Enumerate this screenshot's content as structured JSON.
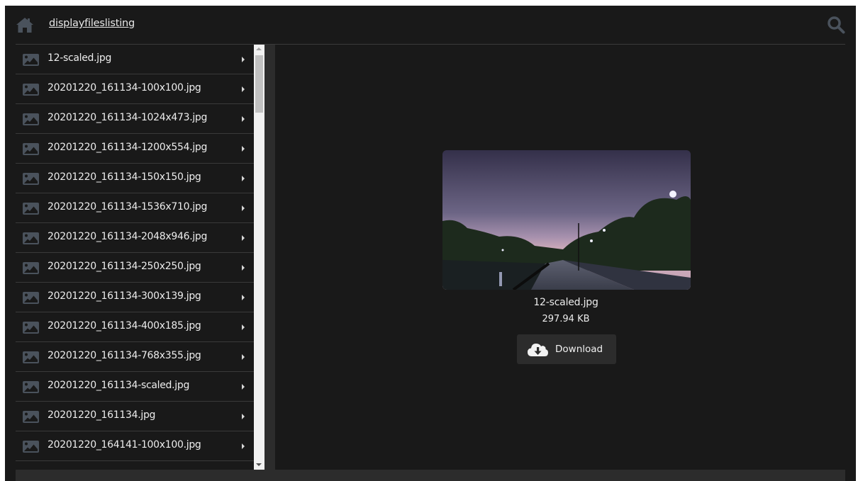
{
  "header": {
    "home_icon": "home-icon",
    "title": "displayfileslisting",
    "search_icon": "search-icon"
  },
  "files": [
    {
      "name": "12-scaled.jpg",
      "icon": "image-icon"
    },
    {
      "name": "20201220_161134-100x100.jpg",
      "icon": "image-icon"
    },
    {
      "name": "20201220_161134-1024x473.jpg",
      "icon": "image-icon"
    },
    {
      "name": "20201220_161134-1200x554.jpg",
      "icon": "image-icon"
    },
    {
      "name": "20201220_161134-150x150.jpg",
      "icon": "image-icon"
    },
    {
      "name": "20201220_161134-1536x710.jpg",
      "icon": "image-icon"
    },
    {
      "name": "20201220_161134-2048x946.jpg",
      "icon": "image-icon"
    },
    {
      "name": "20201220_161134-250x250.jpg",
      "icon": "image-icon"
    },
    {
      "name": "20201220_161134-300x139.jpg",
      "icon": "image-icon"
    },
    {
      "name": "20201220_161134-400x185.jpg",
      "icon": "image-icon"
    },
    {
      "name": "20201220_161134-768x355.jpg",
      "icon": "image-icon"
    },
    {
      "name": "20201220_161134-scaled.jpg",
      "icon": "image-icon"
    },
    {
      "name": "20201220_161134.jpg",
      "icon": "image-icon"
    },
    {
      "name": "20201220_164141-100x100.jpg",
      "icon": "image-icon"
    }
  ],
  "preview": {
    "file_name": "12-scaled.jpg",
    "file_size": "297.94 KB",
    "download_label": "Download",
    "download_icon": "cloud-download-icon"
  },
  "colors": {
    "background": "#191919",
    "panel": "#2c2c2c",
    "icon": "#4a525c",
    "text": "#ececec"
  }
}
